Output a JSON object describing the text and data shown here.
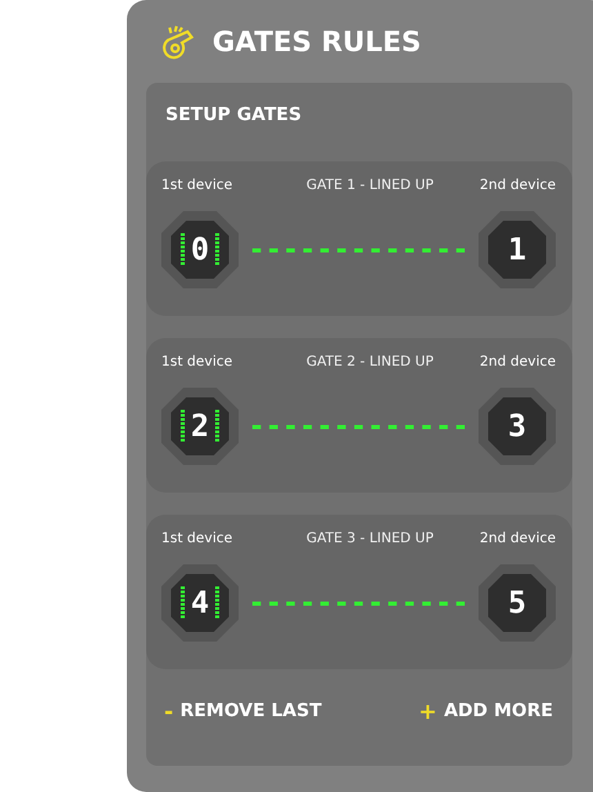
{
  "panel": {
    "title": "GATES RULES"
  },
  "setup": {
    "title": "SETUP GATES",
    "gates": [
      {
        "label": "GATE 1 - LINED UP",
        "connected": true,
        "first": {
          "caption": "1st device",
          "number": "0",
          "active": true
        },
        "second": {
          "caption": "2nd device",
          "number": "1",
          "active": false
        }
      },
      {
        "label": "GATE 2 - LINED UP",
        "connected": true,
        "first": {
          "caption": "1st device",
          "number": "2",
          "active": true
        },
        "second": {
          "caption": "2nd device",
          "number": "3",
          "active": false
        }
      },
      {
        "label": "GATE 3 - LINED UP",
        "connected": true,
        "first": {
          "caption": "1st device",
          "number": "4",
          "active": true
        },
        "second": {
          "caption": "2nd device",
          "number": "5",
          "active": false
        }
      }
    ],
    "actions": [
      {
        "symbol": "-",
        "label": "REMOVE LAST"
      },
      {
        "symbol": "+",
        "label": "ADD MORE"
      }
    ]
  }
}
